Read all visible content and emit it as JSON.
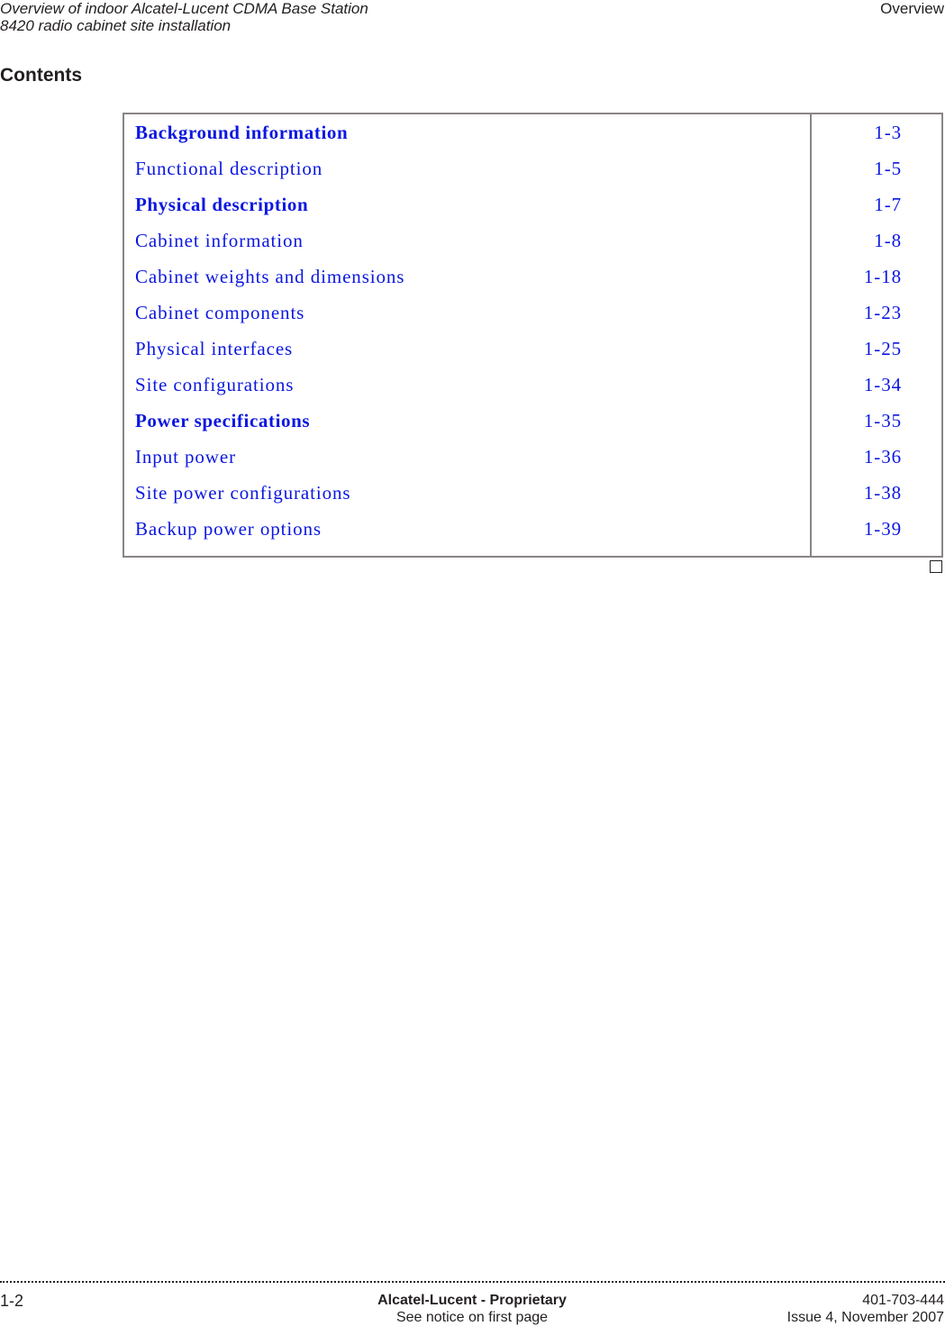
{
  "header": {
    "title_line1": "Overview of indoor Alcatel-Lucent CDMA Base Station",
    "title_line2": "8420 radio cabinet site installation",
    "section": "Overview"
  },
  "contents": {
    "title": "Contents",
    "link_color": "#0b17e0",
    "entries": [
      {
        "title": "Background information",
        "page": "1-3",
        "bold": true
      },
      {
        "title": "Functional description",
        "page": "1-5",
        "bold": false
      },
      {
        "title": "Physical description",
        "page": "1-7",
        "bold": true
      },
      {
        "title": "Cabinet information",
        "page": "1-8",
        "bold": false
      },
      {
        "title": "Cabinet weights and dimensions",
        "page": "1-18",
        "bold": false
      },
      {
        "title": "Cabinet components",
        "page": "1-23",
        "bold": false
      },
      {
        "title": "Physical interfaces",
        "page": "1-25",
        "bold": false
      },
      {
        "title": "Site configurations",
        "page": "1-34",
        "bold": false
      },
      {
        "title": "Power specifications",
        "page": "1-35",
        "bold": true
      },
      {
        "title": "Input power",
        "page": "1-36",
        "bold": false
      },
      {
        "title": "Site power configurations",
        "page": "1-38",
        "bold": false
      },
      {
        "title": "Backup power options",
        "page": "1-39",
        "bold": false
      }
    ]
  },
  "footer": {
    "page_number": "1-2",
    "proprietary": "Alcatel-Lucent - Proprietary",
    "notice": "See notice on first page",
    "doc_number": "401-703-444",
    "issue": "Issue 4, November 2007"
  }
}
